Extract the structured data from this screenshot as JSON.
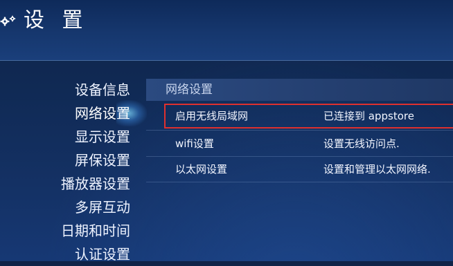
{
  "header": {
    "title": "设 置",
    "icon": "gear-icon"
  },
  "nav": {
    "items": [
      {
        "label": "设备信息"
      },
      {
        "label": "网络设置",
        "active": true
      },
      {
        "label": "显示设置"
      },
      {
        "label": "屏保设置"
      },
      {
        "label": "播放器设置"
      },
      {
        "label": "多屏互动"
      },
      {
        "label": "日期和时间"
      },
      {
        "label": "认证设置"
      }
    ]
  },
  "panel": {
    "title": "网络设置",
    "rows": [
      {
        "label": "启用无线局域网",
        "value": "已连接到 appstore",
        "highlighted": true
      },
      {
        "label": "wifi设置",
        "value": "设置无线访问点."
      },
      {
        "label": "以太网设置",
        "value": "设置和管理以太网网络."
      }
    ]
  },
  "colors": {
    "highlight_border": "#e0302e",
    "background": "#123064",
    "panel_header": "#2b4a80"
  }
}
